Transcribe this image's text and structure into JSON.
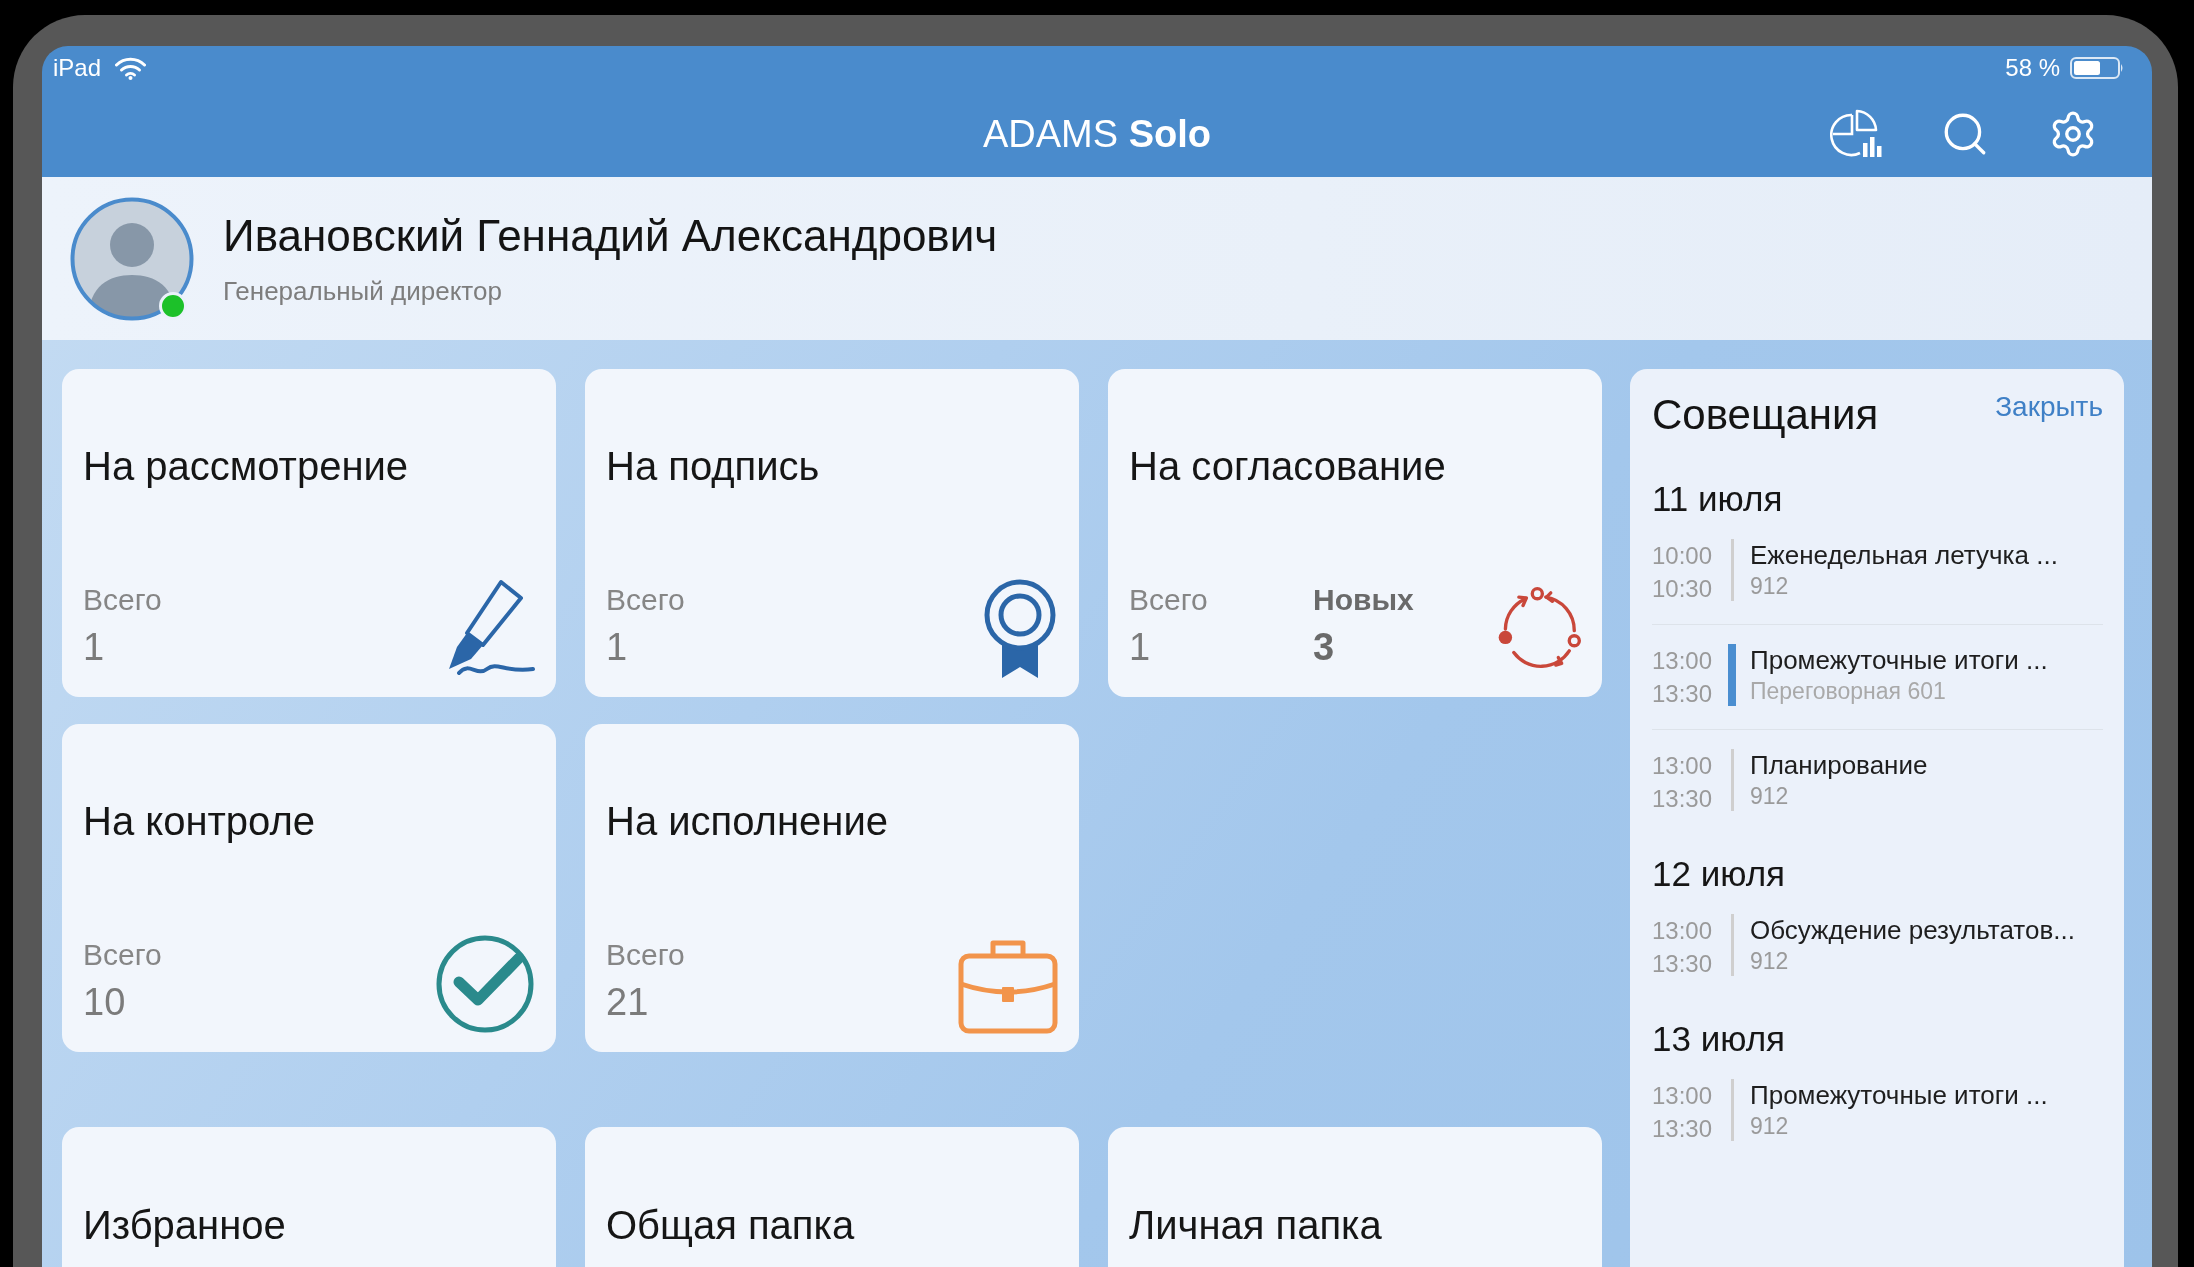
{
  "status_bar": {
    "device": "iPad",
    "battery": "58 %"
  },
  "nav_bar": {
    "title": "ADAMS **Solo**"
  },
  "profile": {
    "name": "Ивановский Геннадий Александрович",
    "position": "Генеральный директор",
    "online": true
  },
  "tiles": [
    {
      "kind": "review",
      "title": "На рассмотрение",
      "stats": [
        {
          "label": "Всего",
          "value": "1",
          "bold": false
        }
      ]
    },
    {
      "kind": "sign",
      "title": "На подпись",
      "stats": [
        {
          "label": "Всего",
          "value": "1",
          "bold": false
        }
      ]
    },
    {
      "kind": "approve",
      "title": "На согласование",
      "stats": [
        {
          "label": "Всего",
          "value": "1",
          "bold": false
        },
        {
          "label": "Новых",
          "value": "3",
          "bold": true
        }
      ]
    },
    {
      "kind": "control",
      "title": "На контроле",
      "stats": [
        {
          "label": "Всего",
          "value": "10",
          "bold": false
        }
      ]
    },
    {
      "kind": "execute",
      "title": "На исполнение",
      "stats": [
        {
          "label": "Всего",
          "value": "21",
          "bold": false
        }
      ]
    }
  ],
  "folders": [
    {
      "title": "Избранное"
    },
    {
      "title": "Общая папка"
    },
    {
      "title": "Личная папка"
    }
  ],
  "meetings": {
    "title": "Совещания",
    "close": "Закрыть",
    "days": [
      {
        "date": "11 июля",
        "items": [
          {
            "start": "10:00",
            "end": "10:30",
            "title": "Еженедельная летучка ...",
            "place": "912",
            "highlighted": false
          },
          {
            "start": "13:00",
            "end": "13:30",
            "title": "Промежуточные итоги ...",
            "place": "Переговорная 601",
            "highlighted": true
          },
          {
            "start": "13:00",
            "end": "13:30",
            "title": "Планирование",
            "place": "912",
            "highlighted": false
          }
        ]
      },
      {
        "date": "12 июля",
        "items": [
          {
            "start": "13:00",
            "end": "13:30",
            "title": "Обсуждение результатов...",
            "place": "912",
            "highlighted": false
          }
        ]
      },
      {
        "date": "13 июля",
        "items": [
          {
            "start": "13:00",
            "end": "13:30",
            "title": "Промежуточные итоги ...",
            "place": "912",
            "highlighted": false
          }
        ]
      }
    ]
  }
}
